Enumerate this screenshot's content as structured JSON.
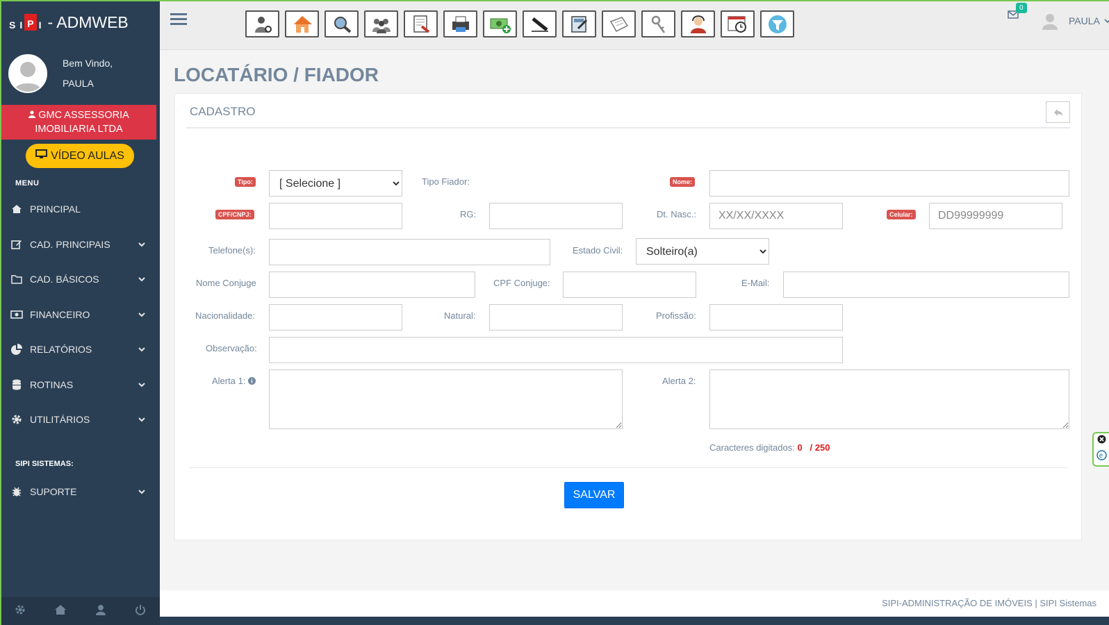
{
  "brand": {
    "logo_letters": [
      "S",
      "I",
      "P",
      "I"
    ],
    "name": "- ADMWEB"
  },
  "profile": {
    "welcome": "Bem Vindo,",
    "user": "PAULA"
  },
  "company": "GMC ASSESSORIA IMOBILIARIA LTDA",
  "video_button": "VÍDEO AULAS",
  "menu_title": "MENU",
  "nav": [
    {
      "label": "PRINCIPAL",
      "icon": "home-icon"
    },
    {
      "label": "CAD. PRINCIPAIS",
      "icon": "edit-icon"
    },
    {
      "label": "CAD. BÁSICOS",
      "icon": "folder-icon"
    },
    {
      "label": "FINANCEIRO",
      "icon": "money-icon"
    },
    {
      "label": "RELATÓRIOS",
      "icon": "pie-chart-icon"
    },
    {
      "label": "ROTINAS",
      "icon": "database-icon"
    },
    {
      "label": "UTILITÁRIOS",
      "icon": "gear-icon"
    }
  ],
  "sipi_title": "SIPI SISTEMAS:",
  "support": {
    "label": "SUPORTE",
    "icon": "bug-icon"
  },
  "topbar": {
    "mail_count": "0",
    "user": "PAULA"
  },
  "page_title": "LOCATÁRIO / FIADOR",
  "panel_title": "CADASTRO",
  "form": {
    "tipo_badge": "Tipo:",
    "tipo_value": "[ Selecione ]",
    "tipo_fiador": "Tipo Fiador:",
    "nome_badge": "Nome:",
    "cpf_badge": "CPF/CNPJ:",
    "rg": "RG:",
    "dt_nasc": "Dt. Nasc.:",
    "dt_nasc_placeholder": "XX/XX/XXXX",
    "celular_badge": "Celular:",
    "celular_placeholder": "DD99999999",
    "telefone": "Telefone(s):",
    "estado_civil": "Estado Civil:",
    "estado_civil_value": "Solteiro(a)",
    "nome_conjuge": "Nome Conjuge",
    "cpf_conjuge": "CPF Conjuge:",
    "email": "E-Mail:",
    "nacionalidade": "Nacionalidade:",
    "natural": "Natural:",
    "profissao": "Profissão:",
    "observacao": "Observação:",
    "alerta1": "Alerta 1:",
    "alerta2": "Alerta 2:",
    "counter_label": "Caracteres digitados:",
    "counter_value": "0",
    "counter_max": "/ 250"
  },
  "save_button": "SALVAR",
  "footer": "SIPI-ADMINISTRAÇÃO DE IMÓVEIS | SIPI Sistemas",
  "colors": {
    "sidebar": "#2a3f54",
    "danger": "#dc3545",
    "warning": "#ffc107",
    "primary": "#007bff"
  }
}
